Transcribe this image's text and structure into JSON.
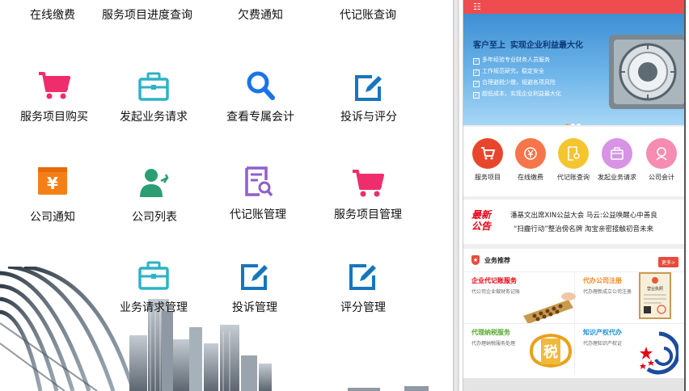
{
  "dashboard": {
    "row1": [
      "在线缴费",
      "服务项目进度查询",
      "欠费通知",
      "代记账查询"
    ],
    "row2": [
      "服务项目购买",
      "发起业务请求",
      "查看专属会计",
      "投诉与评分"
    ],
    "row3": [
      "公司通知",
      "公司列表",
      "代记账管理",
      "服务项目管理"
    ],
    "row4": [
      "业务请求管理",
      "投诉管理",
      "评分管理"
    ],
    "notice_icon_char": "¥"
  },
  "mobile": {
    "menu_glyph": "☷",
    "banner": {
      "slogan1": "客户至上",
      "slogan2": "实现企业利益最大化",
      "bullets": [
        "多年经验专业财务人员服务",
        "工作规范研究，稳定安全",
        "合理避税少缴，规避各项风险",
        "超低成本，实现企业利益最大化"
      ]
    },
    "quick_links": [
      {
        "label": "服务项目",
        "color": "#e8462c"
      },
      {
        "label": "在线缴费",
        "color": "#f7754a"
      },
      {
        "label": "代记账查询",
        "color": "#f5c530"
      },
      {
        "label": "发起业务请求",
        "color": "#d793e6"
      },
      {
        "label": "公司会计",
        "color": "#f58cb1"
      }
    ],
    "news": {
      "badge_line1": "最新",
      "badge_line2": "公告",
      "line1": "潘基文出席XIN公益大会 马云:公益唤醒心中善良",
      "line2": "“扫霾行动”整治傍名牌 淘宝亲密接触初音未来"
    },
    "business": {
      "title": "业务推荐",
      "more": "更多>",
      "cards": [
        {
          "title": "企业代记账服务",
          "sub": "代公司企业做财务记账",
          "color": "#e60012"
        },
        {
          "title": "代办公司注册",
          "sub": "代办理新成立公司注册",
          "color": "#f08a24"
        },
        {
          "title": "代理纳税服务",
          "sub": "代办理纳税服务处理",
          "color": "#5aa832"
        },
        {
          "title": "知识产权代办",
          "sub": "代办理知识产权证",
          "color": "#1e8fd6"
        }
      ],
      "license_text": "营业执照",
      "tax_char": "税"
    }
  }
}
